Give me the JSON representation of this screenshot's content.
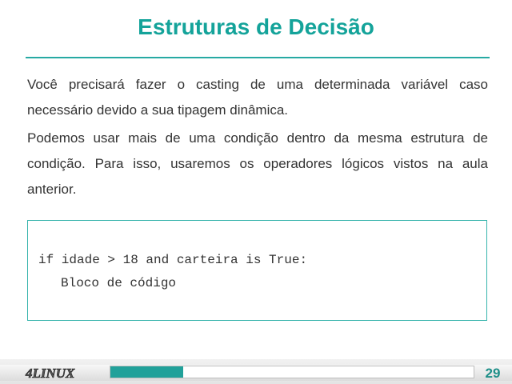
{
  "slide": {
    "title": "Estruturas de Decisão",
    "paragraphs": [
      "Você precisará fazer o casting de uma determinada variável caso necessário devido a sua tipagem dinâmica.",
      "Podemos usar mais de uma condição dentro da mesma estrutura de condição. Para isso, usaremos os operadores lógicos vistos na aula anterior."
    ],
    "code": [
      "if idade > 18 and carteira is True:",
      "Bloco de código"
    ]
  },
  "footer": {
    "logo_text": "4LINUX",
    "page_number": "29",
    "progress_fraction": 0.2
  },
  "colors": {
    "accent": "#14a39a",
    "progress": "#21a19a",
    "text": "#333333"
  }
}
